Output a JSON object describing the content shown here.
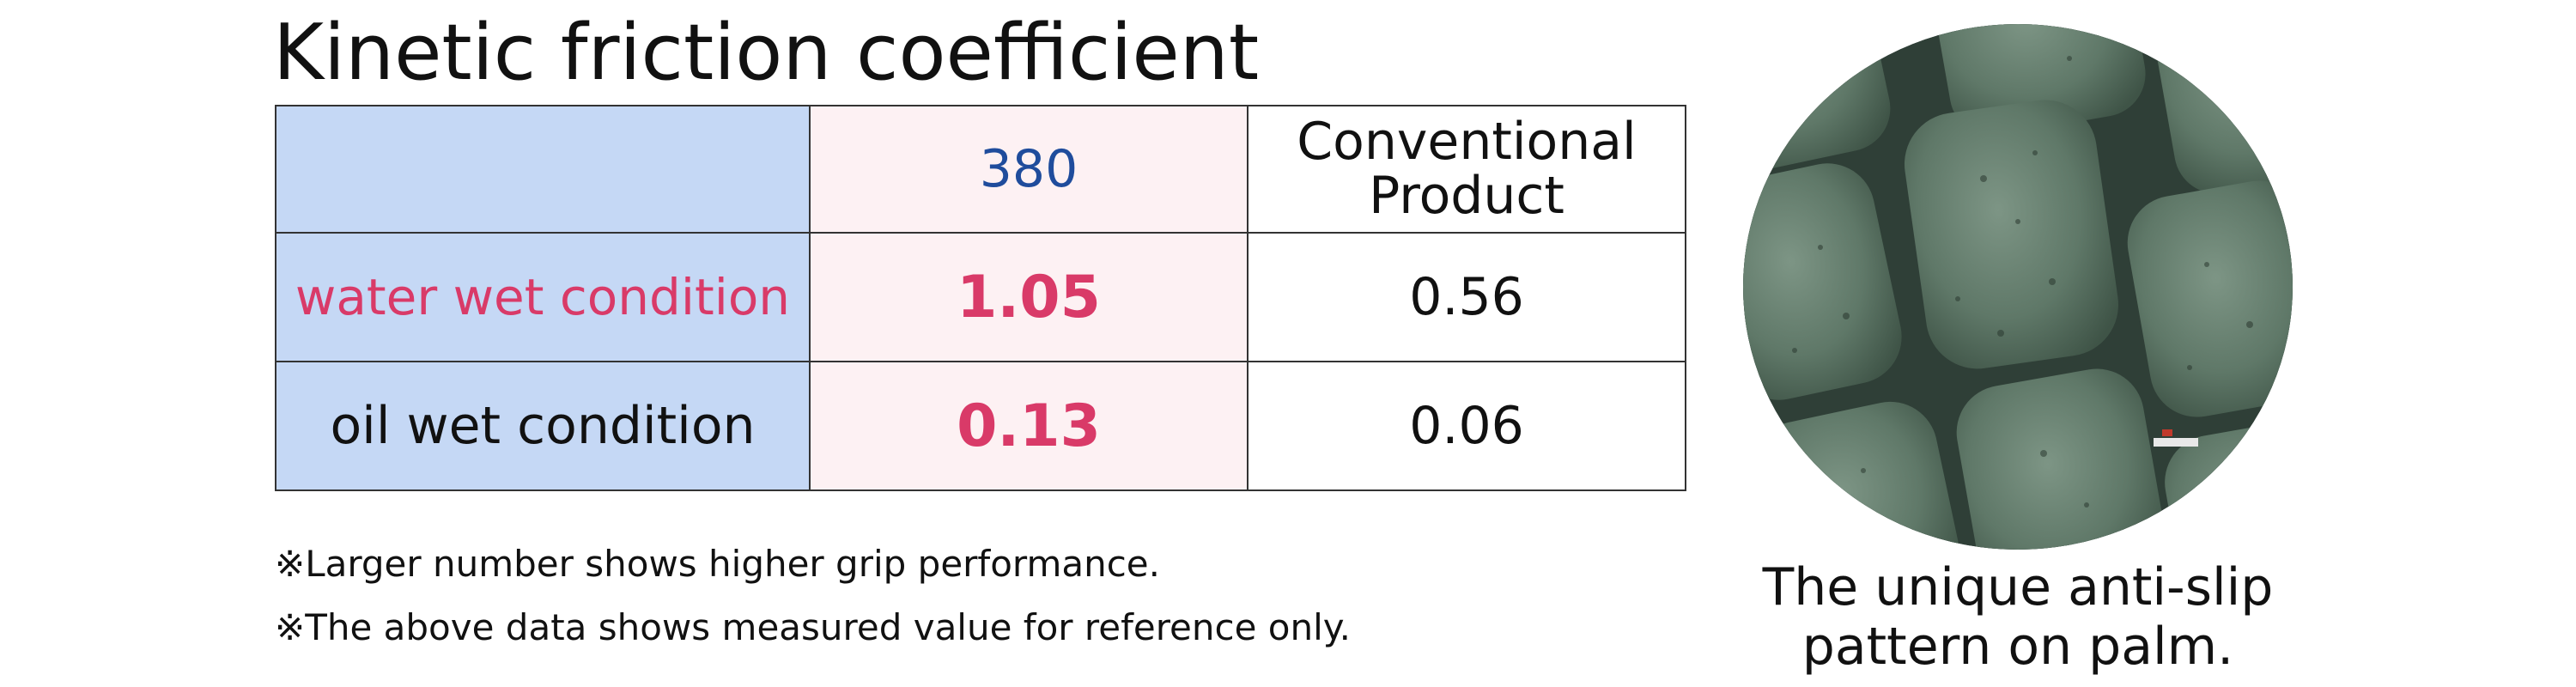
{
  "title": "Kinetic friction coefficient",
  "table": {
    "header": {
      "corner": "",
      "col_380": "380",
      "col_conventional": "Conventional\nProduct"
    },
    "rows": [
      {
        "label": "water wet condition",
        "value_380": "1.05",
        "value_conventional": "0.56"
      },
      {
        "label": "oil wet condition",
        "value_380": "0.13",
        "value_conventional": "0.06"
      }
    ]
  },
  "notes": [
    "※Larger number shows higher grip performance.",
    "※The above data shows measured value for reference only."
  ],
  "palm_image": {
    "icon": "anti-slip-pattern-photo",
    "colors": {
      "background": "#2f3f37",
      "cell": "#5f7868",
      "highlight": "#8da392"
    }
  },
  "caption": "The unique anti-slip pattern on palm.",
  "colors": {
    "label_column_bg": "#c5d8f5",
    "product_column_bg": "#fdf1f3",
    "accent_pink": "#d93a68",
    "accent_blue": "#1f4c9c"
  }
}
